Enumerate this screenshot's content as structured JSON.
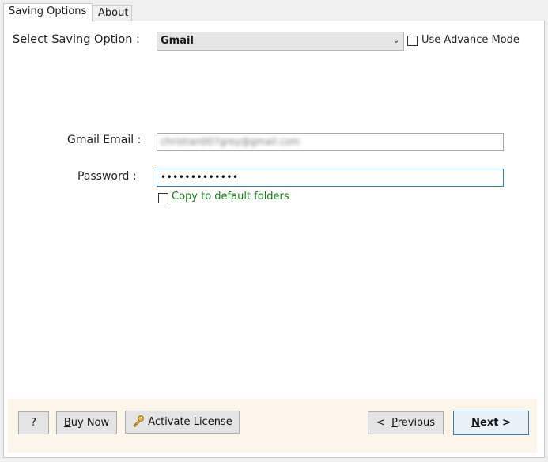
{
  "tabs": [
    {
      "label": "Saving Options",
      "active": true
    },
    {
      "label": "About",
      "active": false
    }
  ],
  "form": {
    "saving_option_label": "Select Saving Option :",
    "saving_option_value": "Gmail",
    "advance_mode_label": "Use Advance Mode",
    "advance_mode_checked": false,
    "email_label": "Gmail Email :",
    "email_value": "christian007grey@gmail.com",
    "password_label": "Password :",
    "password_value": "•••••••••••••",
    "copy_default_label": "Copy to default folders",
    "copy_default_checked": false
  },
  "footer": {
    "help_label": "?",
    "buy_now_prefix": "B",
    "buy_now_rest": "uy Now",
    "activate_prefix": "Activate ",
    "activate_u": "L",
    "activate_rest": "icense",
    "previous_prefix": "<  ",
    "previous_u": "P",
    "previous_rest": "revious",
    "next_prefix": "N",
    "next_rest": "ext >"
  },
  "colors": {
    "footer_bg": "#fdf5e9",
    "green_text": "#1d7a1d",
    "focus_border": "#2f7ad1"
  },
  "icons": {
    "activate": "key-icon",
    "dropdown": "chevron-down-icon"
  }
}
